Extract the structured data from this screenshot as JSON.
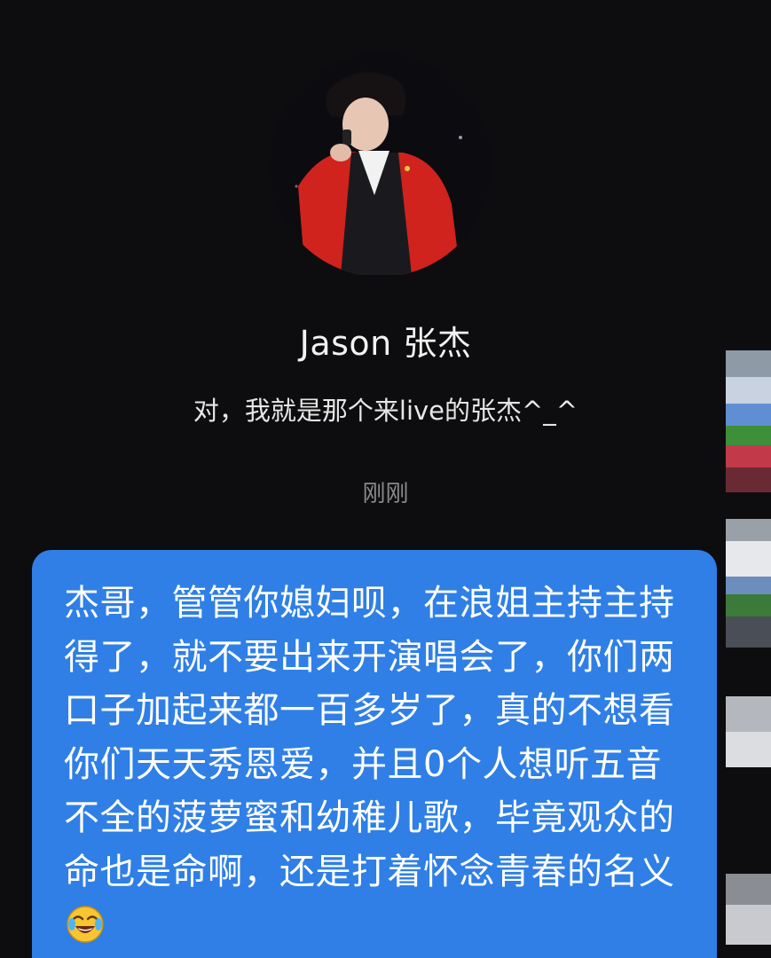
{
  "profile": {
    "name": "Jason 张杰",
    "bio": "对，我就是那个来live的张杰^_^",
    "avatar_icon": "singer-avatar-icon"
  },
  "conversation": {
    "timestamp": "刚刚",
    "message": {
      "text": "杰哥，管管你媳妇呗，在浪姐主持主持得了，就不要出来开演唱会了，你们两口子加起来都一百多岁了，真的不想看你们天天秀恩爱，并且0个人想听五音不全的菠萝蜜和幼稚儿歌，毕竟观众的命也是命啊，还是打着怀念青春的名义",
      "emoji": "laughing-crying-emoji-icon",
      "bubble_color": "#2f7fe6"
    }
  },
  "colors": {
    "background": "#0d0d0f",
    "name_text": "#f2f2f2",
    "timestamp_text": "#8a8a8e"
  }
}
